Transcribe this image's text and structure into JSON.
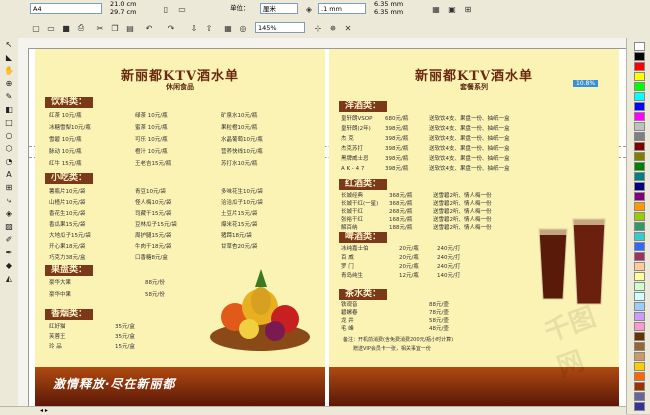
{
  "propertybar": {
    "paper": "A4",
    "width": "21.0 cm",
    "height": "29.7 cm",
    "units_label": "单位：",
    "units": "厘米",
    "nudge": ".1 mm",
    "dup_x": "6.35 mm",
    "dup_y": "6.35 mm"
  },
  "stdbar": {
    "zoom": "145%"
  },
  "colorbadge": "10.8%",
  "left_menu": {
    "title": "新丽都KTV酒水单",
    "subtitle": "休闲食品",
    "drinks": {
      "heading": "饮料类：",
      "rows": [
        [
          "红茶 10元/瓶",
          "绿茶 10元/瓶",
          "矿泉水10元/瓶"
        ],
        [
          "冰糖雪梨10元/瓶",
          "蜜茶 10元/瓶",
          "果粒橙10元/瓶"
        ],
        [
          "雪碧 10元/瓶",
          "可乐 10元/瓶",
          "水晶葡萄10元/瓶"
        ],
        [
          "脉动 10元/瓶",
          "橙汁 10元/瓶",
          "营养快线10元/瓶"
        ],
        [
          "红牛 15元/瓶",
          "王老吉15元/瓶",
          "苏打水10元/瓶"
        ]
      ]
    },
    "snacks": {
      "heading": "小吃类：",
      "rows": [
        [
          "薯瓶片10元/袋",
          "青豆10元/袋",
          "多味花生10元/袋"
        ],
        [
          "山楂片10元/袋",
          "怪人梅10元/袋",
          "洽洽瓜子10元/袋"
        ],
        [
          "香花生10元/袋",
          "司藏干15元/袋",
          "土豆片15元/袋"
        ],
        [
          "香瓜果15元/袋",
          "豆林瓜子15元/袋",
          "爆米花15元/袋"
        ],
        [
          "大地瓜子15元/袋",
          "周护腿15元/袋",
          "猪蹄18元/袋"
        ],
        [
          "开心果18元/袋",
          "牛肉干18元/袋",
          "甘草杏20元/袋"
        ],
        [
          "巧克力38元/盒",
          "口香糖8元/盒",
          ""
        ]
      ]
    },
    "fruit": {
      "heading": "果盘类：",
      "rows": [
        [
          "豪华大果",
          "88元/份"
        ],
        [
          "豪华中果",
          "58元/份"
        ]
      ]
    },
    "tobacco": {
      "heading": "香烟类：",
      "rows": [
        [
          "红好猫",
          "35元/盒"
        ],
        [
          "芙蓉王",
          "35元/盒"
        ],
        [
          "玲 品",
          "15元/盒"
        ]
      ]
    },
    "footer_slogan": "激情释放·尽在新丽都"
  },
  "right_menu": {
    "title": "新丽都KTV酒水单",
    "subtitle": "套餐系列",
    "foreign": {
      "heading": "洋酒类：",
      "rows": [
        [
          "皇轩朗VSOP",
          "680元/瓶",
          "送软饮4支、果盘一份、抽纸一盒"
        ],
        [
          "皇轩朗(2年)",
          "398元/瓶",
          "送软饮4支、果盘一份、抽纸一盒"
        ],
        [
          "杰   克",
          "398元/瓶",
          "送软饮4支、果盘一份、抽纸一盒"
        ],
        [
          "杰克苏打",
          "398元/瓶",
          "送软饮4支、果盘一份、抽纸一盒"
        ],
        [
          "黑牌威士忌",
          "398元/瓶",
          "送软饮4支、果盘一份、抽纸一盒"
        ],
        [
          "A K - 4 7",
          "398元/瓶",
          "送软饮4支、果盘一份、抽纸一盒"
        ]
      ]
    },
    "red": {
      "heading": "红酒类：",
      "rows": [
        [
          "长城经典",
          "368元/瓶",
          "送雪碧2听、情人梅一份"
        ],
        [
          "长城干红(一星)",
          "368元/瓶",
          "送雪碧2听、情人梅一份"
        ],
        [
          "长城干红",
          "268元/瓶",
          "送雪碧2听、情人梅一份"
        ],
        [
          "张裕干红",
          "168元/瓶",
          "送雪碧2听、情人梅一份"
        ],
        [
          "解百纳",
          "188元/瓶",
          "送雪碧2听、情人梅一份"
        ]
      ]
    },
    "beer": {
      "heading": "啤酒类：",
      "rows": [
        [
          "冰纯嘉士伯",
          "20元/瓶",
          "240元/打"
        ],
        [
          "百   威",
          "20元/瓶",
          "240元/打"
        ],
        [
          "罗   门",
          "20元/瓶",
          "240元/打"
        ],
        [
          "青岛纯生",
          "12元/瓶",
          "140元/打"
        ]
      ]
    },
    "tea": {
      "heading": "茶水类：",
      "rows": [
        [
          "铁观音",
          "88元/壶"
        ],
        [
          "碧螺春",
          "78元/壶"
        ],
        [
          "龙   井",
          "58元/壶"
        ],
        [
          "毛   峰",
          "48元/壶"
        ]
      ]
    },
    "note1": "备注：开机前消费(含免费消费200元/瓶小时计算)",
    "note2": "赠送VIP会员卡一张，相关事宜一份"
  },
  "watermark": "千图网"
}
